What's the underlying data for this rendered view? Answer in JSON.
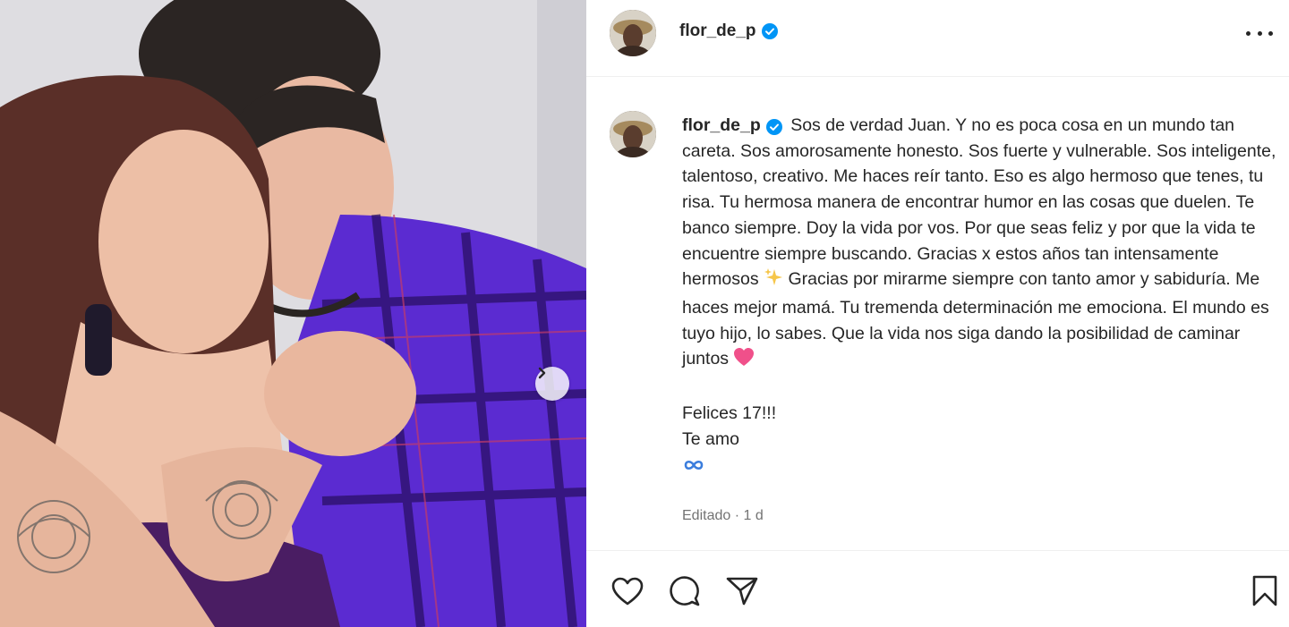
{
  "post": {
    "username": "flor_de_p",
    "verified": true,
    "caption": {
      "body": "Sos de verdad Juan. Y no es poca cosa en un mundo tan careta. Sos amorosamente honesto. Sos fuerte y vulnerable. Sos inteligente, talentoso, creativo. Me haces reír tanto. Eso es algo hermoso que tenes, tu risa. Tu hermosa manera de encontrar humor en las cosas que duelen. Te banco siempre. Doy la vida por vos. Por que seas feliz y por que la vida te encuentre siempre buscando. Gracias x estos años tan intensamente hermosos",
      "body2": "Gracias por mirarme siempre con tanto amor y sabiduría. Me haces mejor mamá. Tu tremenda determinación me emociona. El mundo es tuyo hijo, lo sabes. Que la vida nos siga dando la posibilidad de caminar juntos",
      "line_felices": "Felices 17!!!",
      "line_teamo": "Te amo"
    },
    "meta": "Editado · 1 d"
  },
  "icons": {
    "verified": "verified-badge-icon",
    "sparkles": "sparkles-icon",
    "heart_emoji": "pink-heart-icon",
    "infinity": "infinity-icon",
    "like": "heart-outline-icon",
    "comment": "comment-icon",
    "share": "send-icon",
    "save": "bookmark-icon",
    "next": "chevron-right-icon",
    "more": "more-horizontal-icon"
  },
  "colors": {
    "verified": "#0095f6",
    "heart_emoji": "#f0508a",
    "sparkles": "#f6c64a",
    "infinity": "#3b7ddd",
    "meta_text": "#737373"
  }
}
